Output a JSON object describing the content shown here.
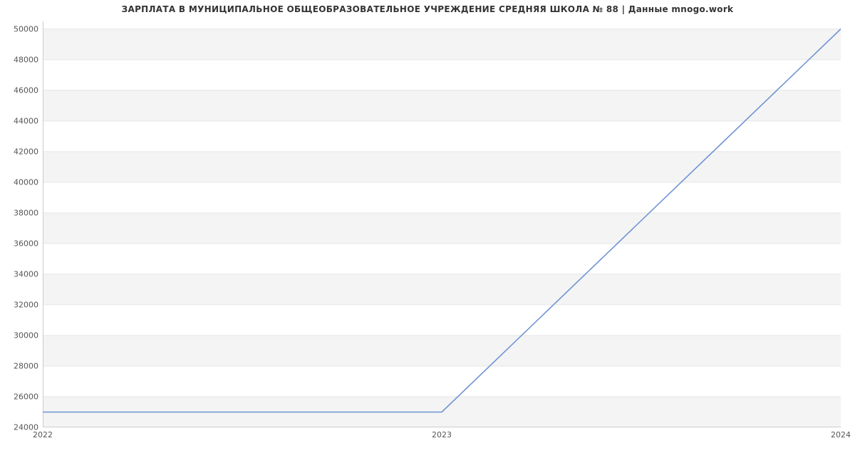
{
  "chart_data": {
    "type": "line",
    "title": "ЗАРПЛАТА В МУНИЦИПАЛЬНОЕ ОБЩЕОБРАЗОВАТЕЛЬНОЕ УЧРЕЖДЕНИЕ СРЕДНЯЯ ШКОЛА № 88 | Данные mnogo.work",
    "x": [
      2022,
      2023,
      2024
    ],
    "values": [
      25000,
      25000,
      50000
    ],
    "xlabel": "",
    "ylabel": "",
    "x_ticks": [
      2022,
      2023,
      2024
    ],
    "y_ticks": [
      24000,
      26000,
      28000,
      30000,
      32000,
      34000,
      36000,
      38000,
      40000,
      42000,
      44000,
      46000,
      48000,
      50000
    ],
    "xlim": [
      2022,
      2024
    ],
    "ylim": [
      24000,
      50500
    ],
    "grid_bands": true,
    "line_color": "#6f94d4"
  }
}
